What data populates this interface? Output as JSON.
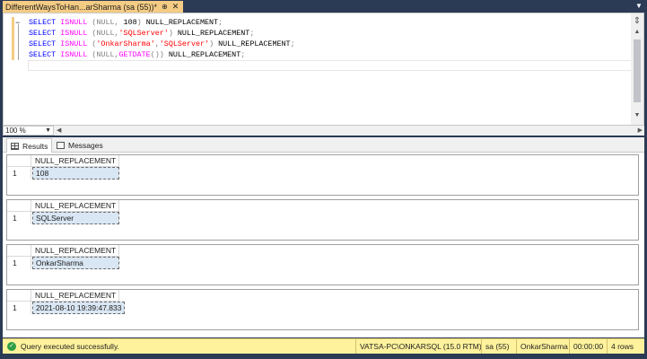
{
  "tab": {
    "title": "DifferentWaysToHan...arSharma (sa (55))*",
    "pin_glyph": "⊕",
    "close_glyph": "✕"
  },
  "editor": {
    "lines": [
      [
        {
          "t": "SELECT",
          "c": "kw"
        },
        {
          "t": " ",
          "c": "tx"
        },
        {
          "t": "ISNULL",
          "c": "fn"
        },
        {
          "t": " ",
          "c": "tx"
        },
        {
          "t": "(NULL,",
          "c": "gr"
        },
        {
          "t": " 108",
          "c": "tx"
        },
        {
          "t": ")",
          "c": "gr"
        },
        {
          "t": " NULL_REPLACEMENT",
          "c": "tx"
        },
        {
          "t": ";",
          "c": "gr"
        }
      ],
      [
        {
          "t": "SELECT",
          "c": "kw"
        },
        {
          "t": " ",
          "c": "tx"
        },
        {
          "t": "ISNULL",
          "c": "fn"
        },
        {
          "t": " ",
          "c": "tx"
        },
        {
          "t": "(NULL,",
          "c": "gr"
        },
        {
          "t": "'SQLServer'",
          "c": "st"
        },
        {
          "t": ")",
          "c": "gr"
        },
        {
          "t": " NULL_REPLACEMENT",
          "c": "tx"
        },
        {
          "t": ";",
          "c": "gr"
        }
      ],
      [
        {
          "t": "SELECT",
          "c": "kw"
        },
        {
          "t": " ",
          "c": "tx"
        },
        {
          "t": "ISNULL",
          "c": "fn"
        },
        {
          "t": " ",
          "c": "tx"
        },
        {
          "t": "(",
          "c": "gr"
        },
        {
          "t": "'OnkarSharma'",
          "c": "st"
        },
        {
          "t": ",",
          "c": "gr"
        },
        {
          "t": "'SQLServer'",
          "c": "st"
        },
        {
          "t": ")",
          "c": "gr"
        },
        {
          "t": " NULL_REPLACEMENT",
          "c": "tx"
        },
        {
          "t": ";",
          "c": "gr"
        }
      ],
      [
        {
          "t": "SELECT",
          "c": "kw"
        },
        {
          "t": " ",
          "c": "tx"
        },
        {
          "t": "ISNULL",
          "c": "fn"
        },
        {
          "t": " ",
          "c": "tx"
        },
        {
          "t": "(NULL,",
          "c": "gr"
        },
        {
          "t": "GETDATE",
          "c": "fn"
        },
        {
          "t": "())",
          "c": "gr"
        },
        {
          "t": " NULL_REPLACEMENT",
          "c": "tx"
        },
        {
          "t": ";",
          "c": "gr"
        }
      ]
    ]
  },
  "zoom": {
    "value": "100 %"
  },
  "results_tabs": {
    "results_label": "Results",
    "messages_label": "Messages"
  },
  "result_grids": [
    {
      "column": "NULL_REPLACEMENT",
      "row_number": "1",
      "value": "108"
    },
    {
      "column": "NULL_REPLACEMENT",
      "row_number": "1",
      "value": "SQLServer"
    },
    {
      "column": "NULL_REPLACEMENT",
      "row_number": "1",
      "value": "OnkarSharma"
    },
    {
      "column": "NULL_REPLACEMENT",
      "row_number": "1",
      "value": "2021-08-10 19:39:47.833"
    }
  ],
  "status": {
    "message": "Query executed successfully.",
    "server": "VATSA-PC\\ONKARSQL (15.0 RTM)",
    "session": "sa (55)",
    "database": "OnkarSharma",
    "elapsed": "00:00:00",
    "rows": "4 rows"
  },
  "colors": {
    "tab_active": "#f5cc84",
    "status_bar": "#fff29d",
    "chrome": "#2b3a55",
    "cell_selected": "#d9e6f3"
  }
}
